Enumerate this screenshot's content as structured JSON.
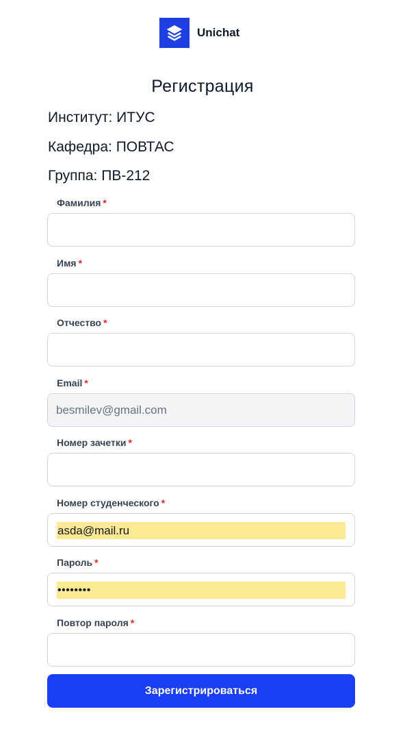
{
  "brand": {
    "name": "Unichat",
    "logo_icon": "layers-icon",
    "color": "#1d3fe3"
  },
  "page": {
    "title": "Регистрация",
    "institute": "Институт: ИТУС",
    "department": "Кафедра: ПОВТАС",
    "group": "Группа: ПВ-212"
  },
  "form": {
    "required_mark": "*",
    "fields": [
      {
        "label": "Фамилия",
        "value": ""
      },
      {
        "label": "Имя",
        "value": ""
      },
      {
        "label": "Отчество",
        "value": ""
      },
      {
        "label": "Email",
        "placeholder": "besmilev@gmail.com",
        "disabled": true
      },
      {
        "label": "Номер зачетки",
        "value": ""
      },
      {
        "label": "Номер студенческого",
        "value": "asda@mail.ru",
        "autofilled": true
      },
      {
        "label": "Пароль",
        "value": "••••••••",
        "autofilled": true
      },
      {
        "label": "Повтор пароля",
        "value": ""
      }
    ],
    "submit_label": "Зарегистрироваться",
    "accent_color": "#1a3ff6",
    "autofill_color": "#fde992",
    "required_color": "#e02424"
  }
}
